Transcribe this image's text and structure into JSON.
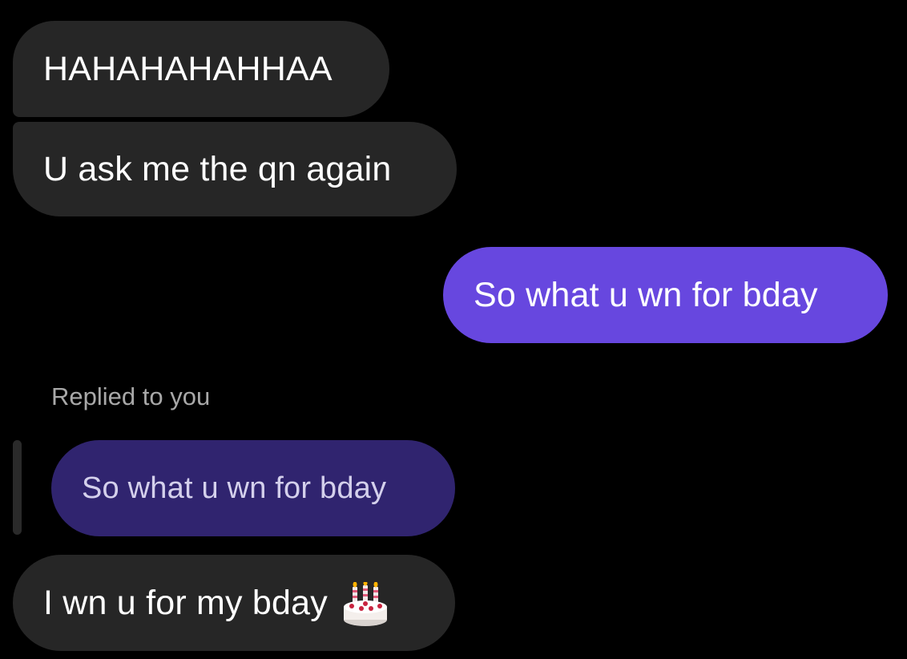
{
  "thread": {
    "messages": [
      {
        "sender": "them",
        "text": "HAHAHAHAHHAA"
      },
      {
        "sender": "them",
        "text": "U ask me the qn again"
      },
      {
        "sender": "me",
        "text": "So what u wn for bday"
      },
      {
        "sender": "them",
        "reply_label": "Replied to you",
        "quoted_text": "So what u wn for bday",
        "text": "I wn u for my bday",
        "emoji": "birthday-cake-icon"
      }
    ]
  },
  "colors": {
    "background": "#000000",
    "incoming_bubble": "#262626",
    "outgoing_bubble": "#6747df",
    "quoted_bubble": "#30246f",
    "reply_label": "#a8a8a8"
  }
}
